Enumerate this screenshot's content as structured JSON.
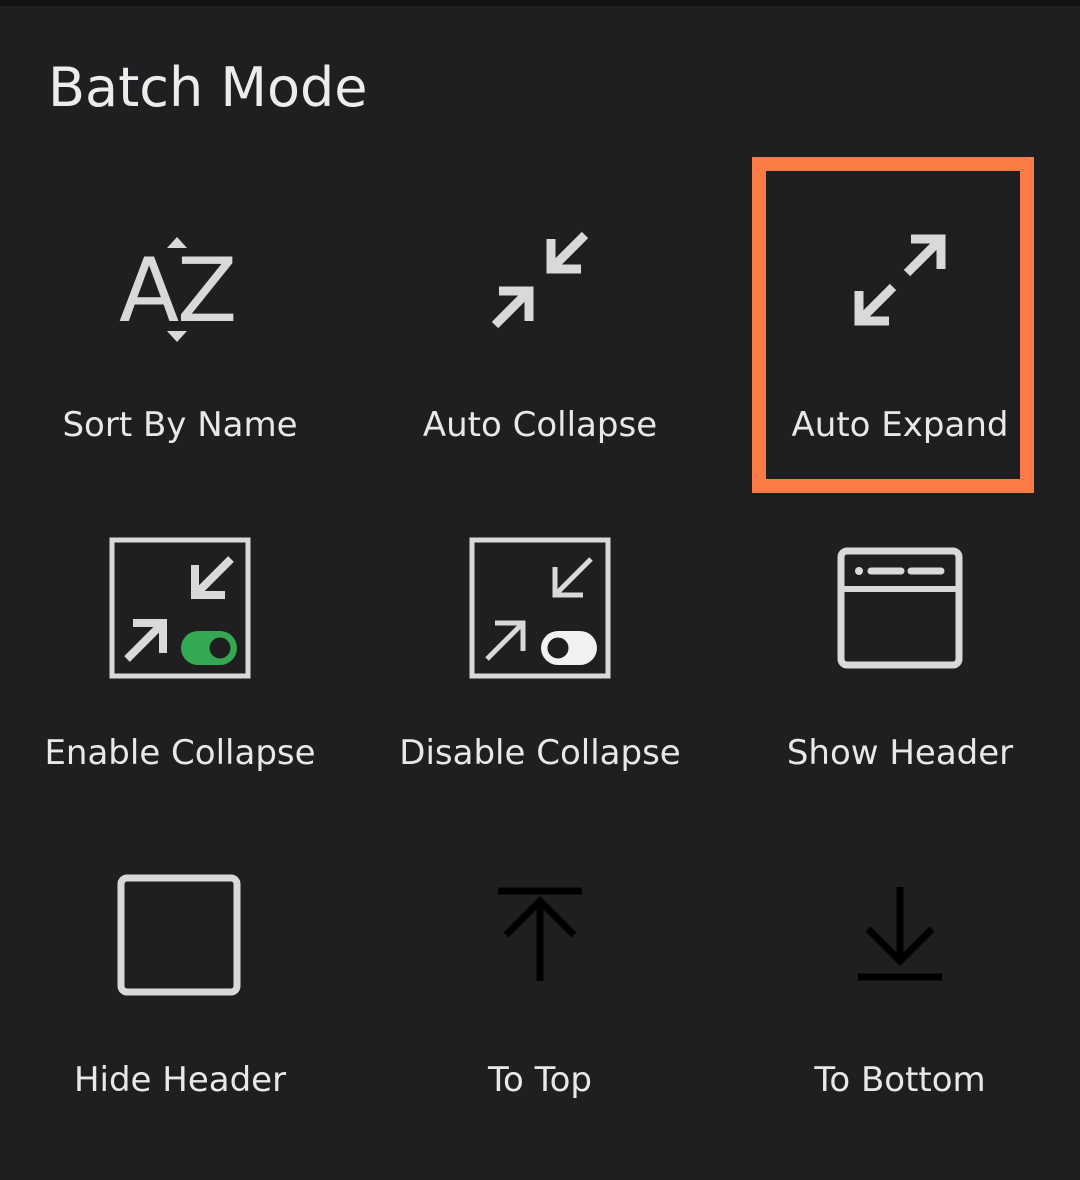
{
  "sheet": {
    "title": "Batch Mode"
  },
  "actions": [
    {
      "id": "sort",
      "label": "Sort By Name",
      "icon": "sort-az-icon"
    },
    {
      "id": "auto-collapse",
      "label": "Auto Collapse",
      "icon": "collapse-arrows-icon"
    },
    {
      "id": "auto-expand",
      "label": "Auto Expand",
      "icon": "expand-arrows-icon",
      "highlighted": true
    },
    {
      "id": "enable-collapse",
      "label": "Enable Collapse",
      "icon": "collapse-toggle-on-icon"
    },
    {
      "id": "disable-collapse",
      "label": "Disable Collapse",
      "icon": "collapse-toggle-off-icon"
    },
    {
      "id": "show-header",
      "label": "Show Header",
      "icon": "window-header-icon"
    },
    {
      "id": "hide-header",
      "label": "Hide Header",
      "icon": "blank-window-icon"
    },
    {
      "id": "to-top",
      "label": "To Top",
      "icon": "arrow-to-top-icon"
    },
    {
      "id": "to-bottom",
      "label": "To Bottom",
      "icon": "arrow-to-bottom-icon"
    }
  ],
  "colors": {
    "background": "#1f1f22",
    "icon": "#d9d9d9",
    "toggle_on": "#34a853",
    "highlight": "#fb7a45"
  }
}
